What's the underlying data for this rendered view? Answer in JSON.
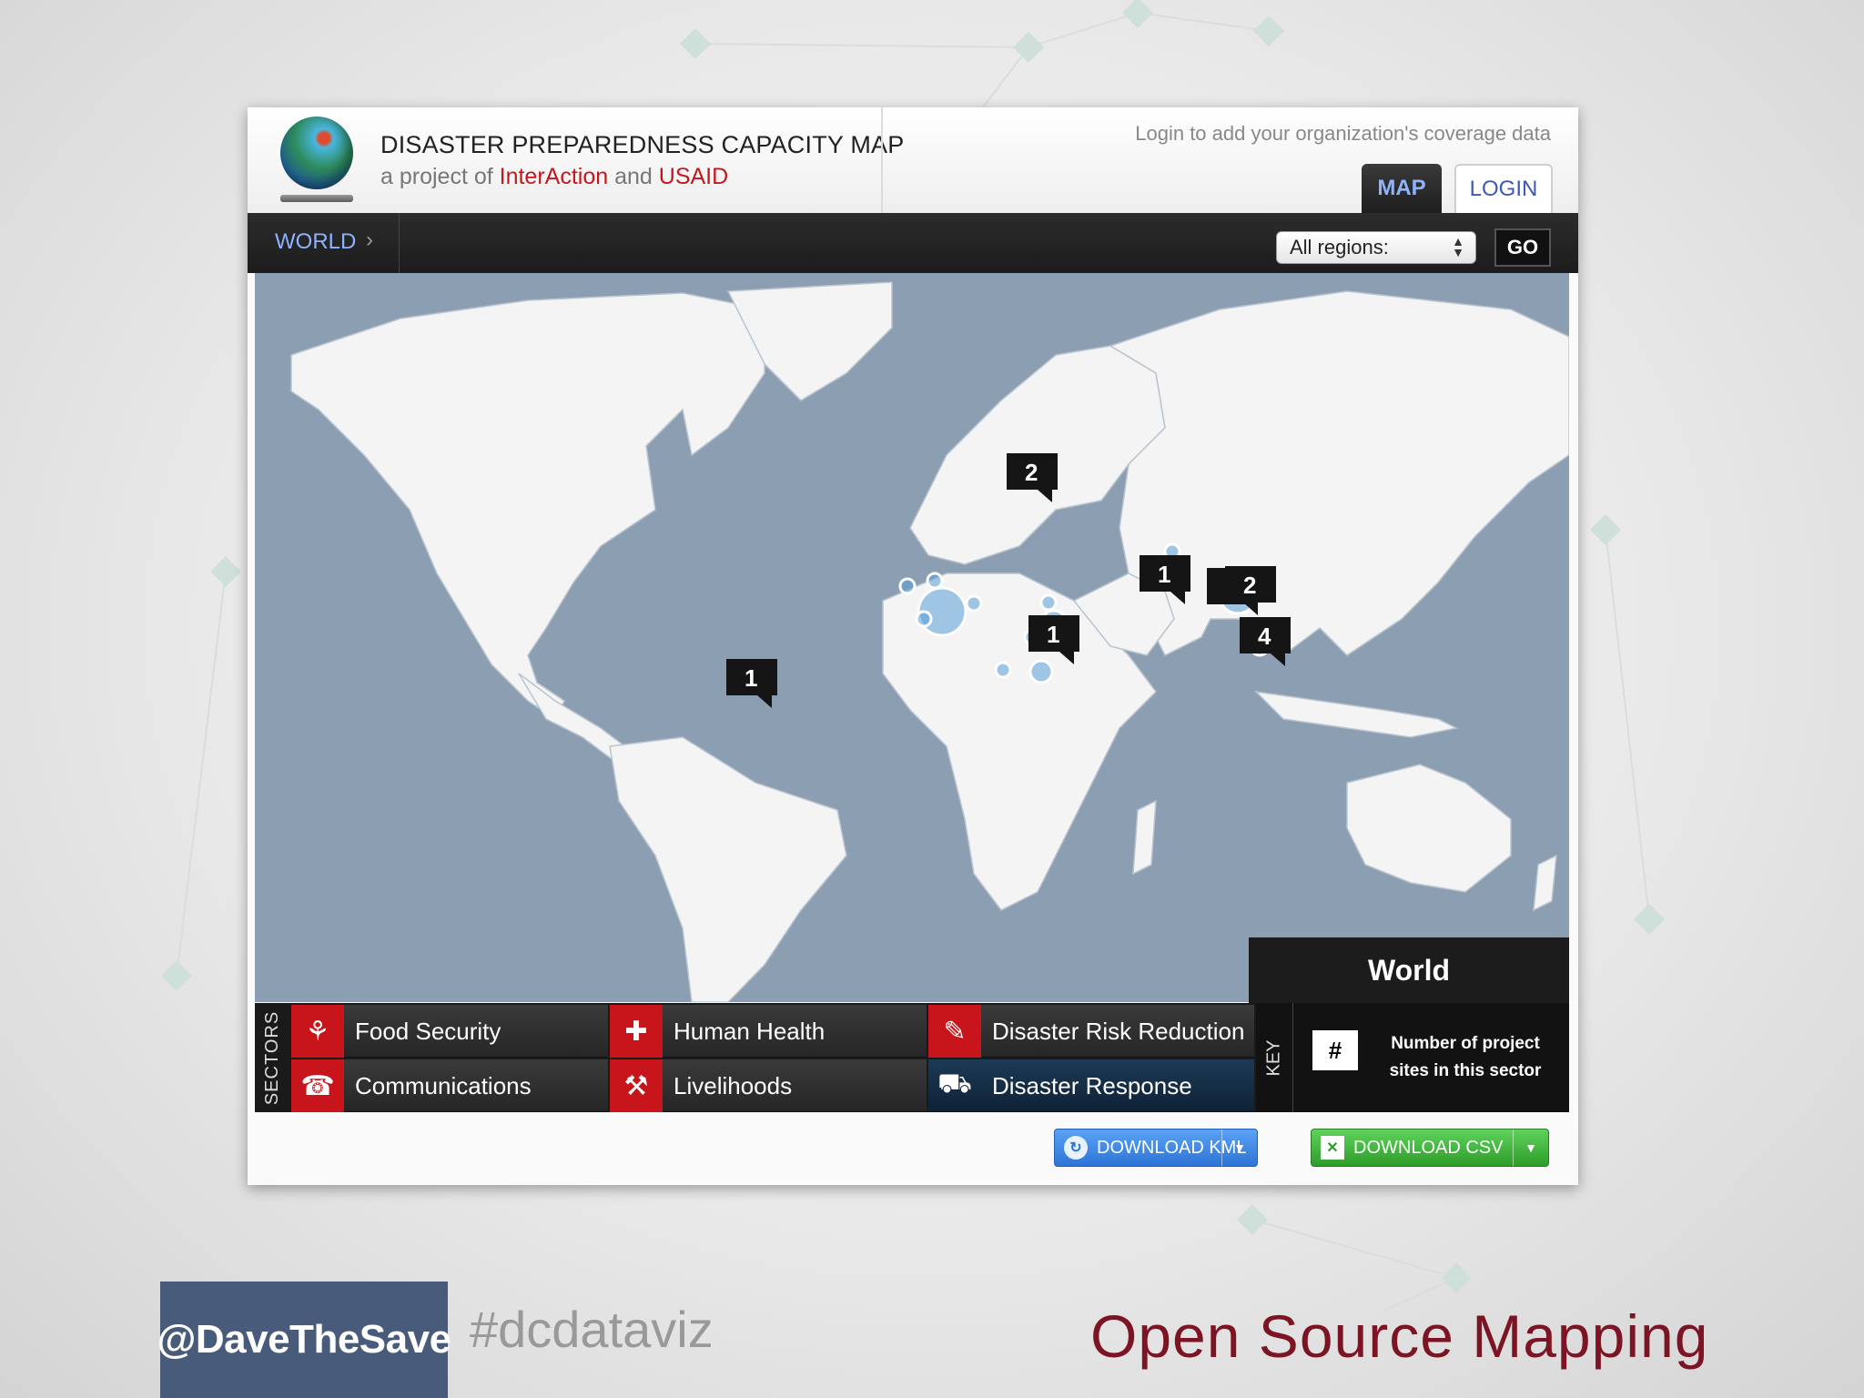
{
  "header": {
    "title": "DISASTER PREPAREDNESS CAPACITY MAP",
    "subtitle_prefix": "a project of",
    "org1": "InterAction",
    "subtitle_and": "and",
    "org2": "USAID",
    "login_hint": "Login to add your organization's coverage data",
    "tabs": {
      "map": "MAP",
      "login": "LOGIN"
    }
  },
  "nav": {
    "breadcrumb": "WORLD",
    "region_select": "All regions:",
    "go": "GO"
  },
  "map": {
    "markers": [
      {
        "count": "2",
        "location": "Eastern Europe"
      },
      {
        "count": "1",
        "location": "South Asia"
      },
      {
        "count": "2",
        "location": "Southeast Asia"
      },
      {
        "count": "1",
        "location": "East Africa"
      },
      {
        "count": "4",
        "location": "Indonesia"
      },
      {
        "count": "1",
        "location": "South America"
      }
    ],
    "panel_title": "World"
  },
  "sectors": {
    "label": "SECTORS",
    "items": [
      {
        "label": "Food Security",
        "icon": "food-security-icon"
      },
      {
        "label": "Human Health",
        "icon": "human-health-icon"
      },
      {
        "label": "Disaster Risk Reduction",
        "icon": "disaster-risk-reduction-icon"
      },
      {
        "label": "Communications",
        "icon": "telephone-icon"
      },
      {
        "label": "Livelihoods",
        "icon": "wrench-icon"
      },
      {
        "label": "Disaster Response",
        "icon": "ambulance-icon"
      }
    ]
  },
  "key": {
    "label": "KEY",
    "marker": "#",
    "text": "Number of project sites in this sector"
  },
  "downloads": {
    "kml": "DOWNLOAD KML",
    "csv": "DOWNLOAD CSV"
  },
  "slide": {
    "handle": "@DaveTheSave",
    "hashtag": "#dcdataviz",
    "title": "Open Source Mapping"
  },
  "colors": {
    "accent_red": "#c8151b",
    "link_blue": "#8cb3ff",
    "ocean": "#8c9fb2",
    "land": "#f4f4f4",
    "title_maroon": "#7d1424"
  }
}
